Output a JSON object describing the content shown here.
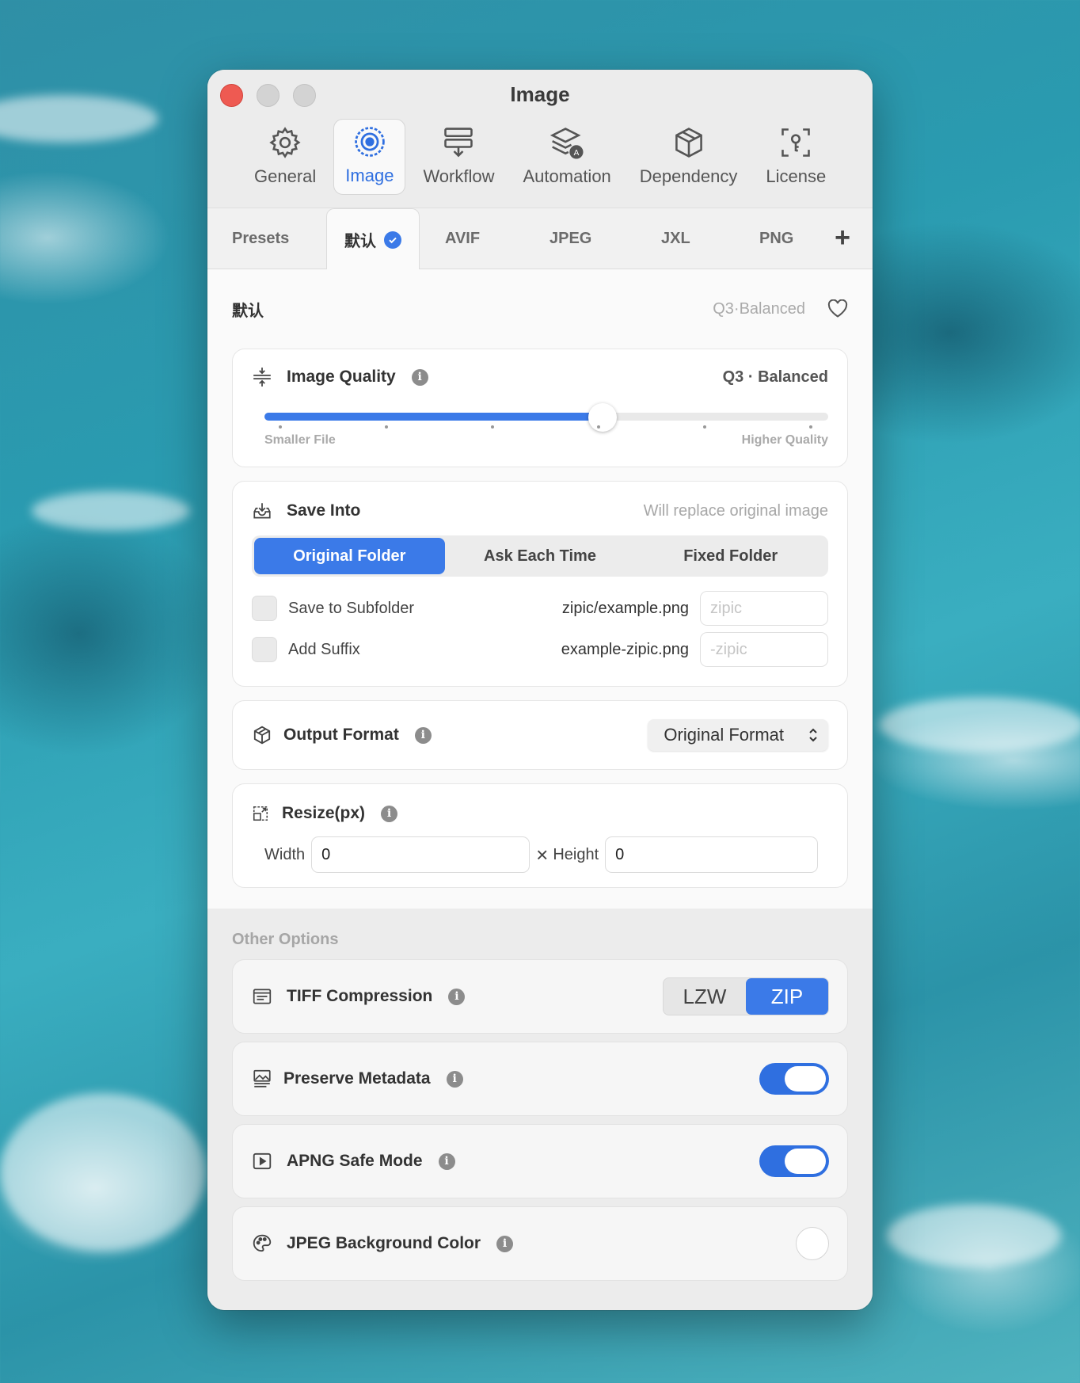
{
  "window": {
    "title": "Image"
  },
  "toolbar": [
    {
      "label": "General",
      "icon": "gear-icon"
    },
    {
      "label": "Image",
      "icon": "target-icon",
      "active": true
    },
    {
      "label": "Workflow",
      "icon": "workflow-icon"
    },
    {
      "label": "Automation",
      "icon": "layers-icon"
    },
    {
      "label": "Dependency",
      "icon": "box-icon"
    },
    {
      "label": "License",
      "icon": "key-icon"
    }
  ],
  "tabs": {
    "presets_label": "Presets",
    "items": [
      "默认",
      "AVIF",
      "JPEG",
      "JXL",
      "PNG"
    ],
    "active": "默认",
    "add": "+"
  },
  "preset": {
    "name": "默认",
    "quality_summary": "Q3·Balanced"
  },
  "quality": {
    "title": "Image Quality",
    "value_label": "Q3 · Balanced",
    "min_label": "Smaller File",
    "max_label": "Higher Quality",
    "level": 0.6
  },
  "save_into": {
    "title": "Save Into",
    "hint": "Will replace original image",
    "options": [
      "Original Folder",
      "Ask Each Time",
      "Fixed Folder"
    ],
    "selected": "Original Folder",
    "subfolder": {
      "label": "Save to Subfolder",
      "example": "zipic/example.png",
      "placeholder": "zipic"
    },
    "suffix": {
      "label": "Add Suffix",
      "example": "example-zipic.png",
      "placeholder": "-zipic"
    }
  },
  "output_format": {
    "title": "Output Format",
    "value": "Original Format"
  },
  "resize": {
    "title": "Resize(px)",
    "width_label": "Width",
    "width": "0",
    "times": "×",
    "height_label": "Height",
    "height": "0"
  },
  "other": {
    "title": "Other Options",
    "tiff": {
      "title": "TIFF Compression",
      "options": [
        "LZW",
        "ZIP"
      ],
      "selected": "ZIP"
    },
    "metadata": {
      "title": "Preserve Metadata",
      "on": true
    },
    "apng": {
      "title": "APNG Safe Mode",
      "on": true
    },
    "jpeg_bg": {
      "title": "JPEG Background Color",
      "color": "#ffffff"
    }
  },
  "colors": {
    "accent": "#3b7ae8",
    "close": "#ee5a52"
  }
}
